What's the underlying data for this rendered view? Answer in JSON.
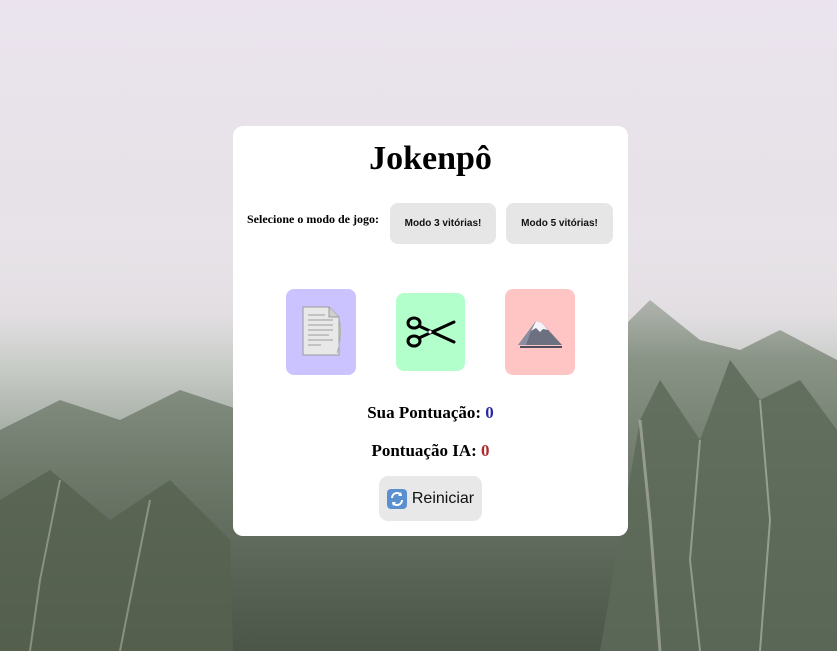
{
  "game": {
    "title": "Jokenpô",
    "mode_label": "Selecione o modo de jogo:",
    "modes": [
      {
        "label": "Modo 3 vitórias!"
      },
      {
        "label": "Modo 5 vitórias!"
      }
    ],
    "choices": [
      {
        "name": "paper",
        "icon": "paper-icon",
        "color": "#cbc3ff"
      },
      {
        "name": "scissors",
        "icon": "scissors-icon",
        "color": "#b3ffcb"
      },
      {
        "name": "rock",
        "icon": "mountain-icon",
        "color": "#ffc5c5"
      }
    ],
    "score_you_label": "Sua Pontuação:",
    "score_you_value": "0",
    "score_ai_label": "Pontuação IA:",
    "score_ai_value": "0",
    "restart_label": "Reiniciar",
    "restart_icon": "refresh-icon"
  },
  "colors": {
    "score_you": "#2b2ba0",
    "score_ai": "#b02a2a"
  }
}
